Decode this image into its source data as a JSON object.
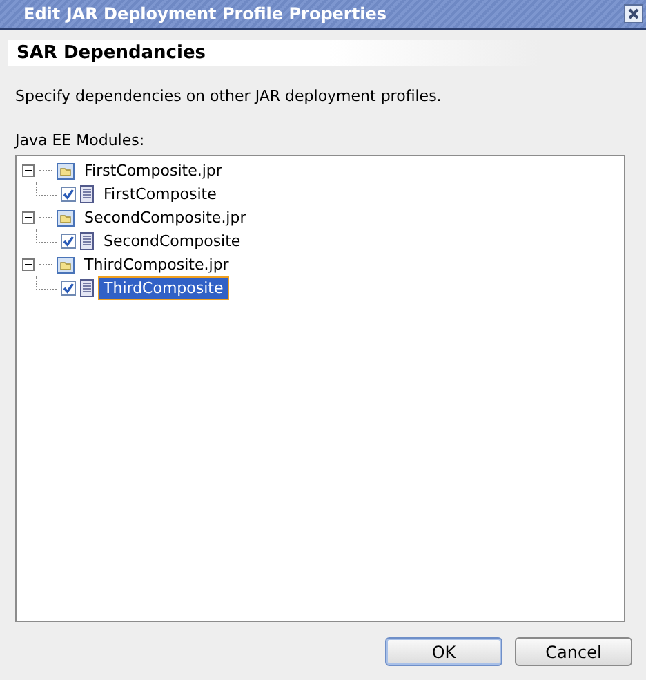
{
  "window": {
    "title": "Edit JAR Deployment Profile Properties"
  },
  "header": "SAR Dependancies",
  "description": "Specify dependencies on other JAR deployment profiles.",
  "modules_label": "Java EE Modules:",
  "tree": [
    {
      "label": "FirstComposite.jpr",
      "expanded": true,
      "selected": false,
      "children": [
        {
          "label": "FirstComposite",
          "checked": true,
          "selected": false
        }
      ]
    },
    {
      "label": "SecondComposite.jpr",
      "expanded": true,
      "selected": false,
      "children": [
        {
          "label": "SecondComposite",
          "checked": true,
          "selected": false
        }
      ]
    },
    {
      "label": "ThirdComposite.jpr",
      "expanded": true,
      "selected": false,
      "children": [
        {
          "label": "ThirdComposite",
          "checked": true,
          "selected": true
        }
      ]
    }
  ],
  "buttons": [
    {
      "label": "OK",
      "default": true
    },
    {
      "label": "Cancel",
      "default": false
    }
  ]
}
